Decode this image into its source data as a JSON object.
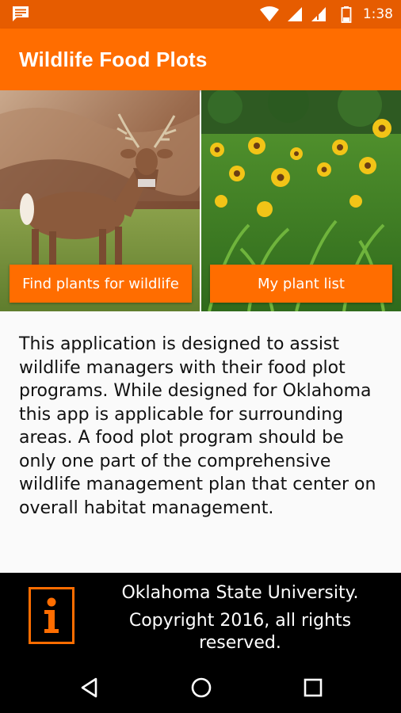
{
  "status_bar": {
    "time": "1:38",
    "icons": [
      "notification-message-icon",
      "wifi-icon",
      "cell-signal-icon",
      "no-sim-signal-icon",
      "battery-icon"
    ]
  },
  "app_bar": {
    "title": "Wildlife Food Plots"
  },
  "panels": {
    "left": {
      "image": "deer-photo",
      "button_label": "Find plants for wildlife"
    },
    "right": {
      "image": "sunflower-field-photo",
      "button_label": "My plant list"
    }
  },
  "description": {
    "lines": [
      "This application is designed to assist",
      "wildlife managers with their food plot",
      "programs. While designed for Oklahoma",
      "this app is applicable for surrounding",
      "areas. A food plot program should be",
      "only one part of the comprehensive",
      "wildlife management plan that center on",
      "overall habitat management."
    ]
  },
  "footer": {
    "icon": "info-icon",
    "lines": [
      "Oklahoma State University.",
      "Copyright 2016, all rights",
      "reserved."
    ]
  },
  "nav_bar": {
    "icons": [
      "back-icon",
      "home-icon",
      "recents-icon"
    ]
  },
  "colors": {
    "status_bar": "#e65c00",
    "accent": "#ff6d00",
    "footer_bg": "#000000",
    "body_bg": "#fafafa"
  }
}
